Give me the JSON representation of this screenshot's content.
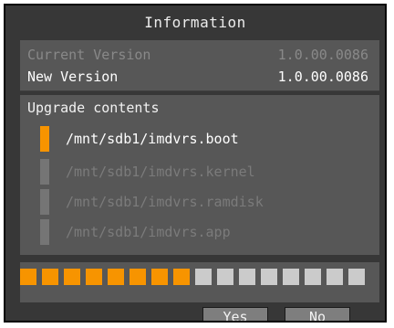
{
  "dialog": {
    "title": "Information"
  },
  "versions": {
    "current": {
      "label": "Current Version",
      "value": "1.0.00.0086"
    },
    "new": {
      "label": "New Version",
      "value": "1.0.00.0086"
    }
  },
  "upgrade": {
    "header": "Upgrade contents",
    "files": [
      {
        "name": "/mnt/sdb1/imdvrs.boot",
        "active": true
      },
      {
        "name": "/mnt/sdb1/imdvrs.kernel",
        "active": false
      },
      {
        "name": "/mnt/sdb1/imdvrs.ramdisk",
        "active": false
      },
      {
        "name": "/mnt/sdb1/imdvrs.app",
        "active": false
      }
    ]
  },
  "progress": {
    "filled_segments": 8,
    "total_segments": 16,
    "fraction": 0.5,
    "filled_color": "#f79400",
    "empty_color": "#cbcbcb"
  },
  "buttons": {
    "yes_label": "Yes",
    "no_label": "No"
  }
}
